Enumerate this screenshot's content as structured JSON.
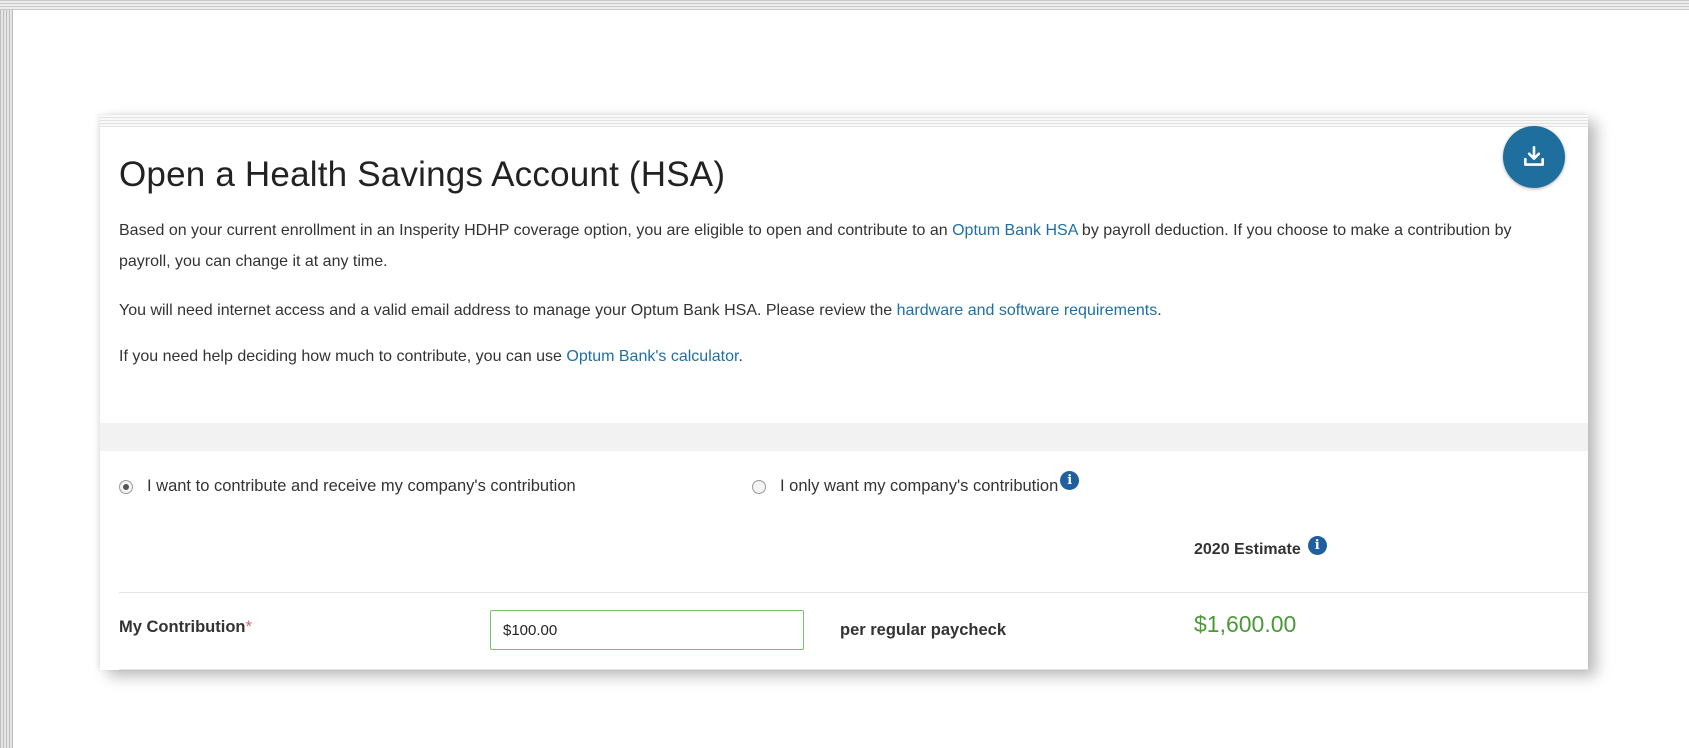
{
  "header": {
    "title": "Open a Health Savings Account (HSA)",
    "download_icon": "download-icon"
  },
  "intro": {
    "p1_before": "Based on your current enrollment in an Insperity HDHP coverage option, you are eligible to open and contribute to an ",
    "p1_link": "Optum Bank HSA",
    "p1_after": " by payroll deduction. If you choose to make a contribution by payroll, you can change it at any time.",
    "p2_before": "You will need internet access and a valid email address to manage your Optum Bank HSA. Please review the ",
    "p2_link": "hardware and software requirements",
    "p2_after": ".",
    "p3_before": "If you need help deciding how much to contribute, you can use ",
    "p3_link": "Optum Bank's calculator",
    "p3_after": "."
  },
  "options": {
    "contribute_label": "I want to contribute and receive my company's contribution",
    "company_only_label": "I only want my company's contribution",
    "selected": "contribute"
  },
  "table": {
    "estimate_header": "2020 Estimate",
    "contribution_label": "My Contribution",
    "required_mark": "*",
    "contribution_value": "$100.00",
    "per_label": "per regular paycheck",
    "estimate_value": "$1,600.00"
  },
  "colors": {
    "link": "#1f6fa6",
    "accent": "#1f6f9e",
    "info": "#1f5fa0",
    "estimate_green": "#4b9a38",
    "input_border_green": "#7cbf6a",
    "required_red": "#e06060"
  }
}
